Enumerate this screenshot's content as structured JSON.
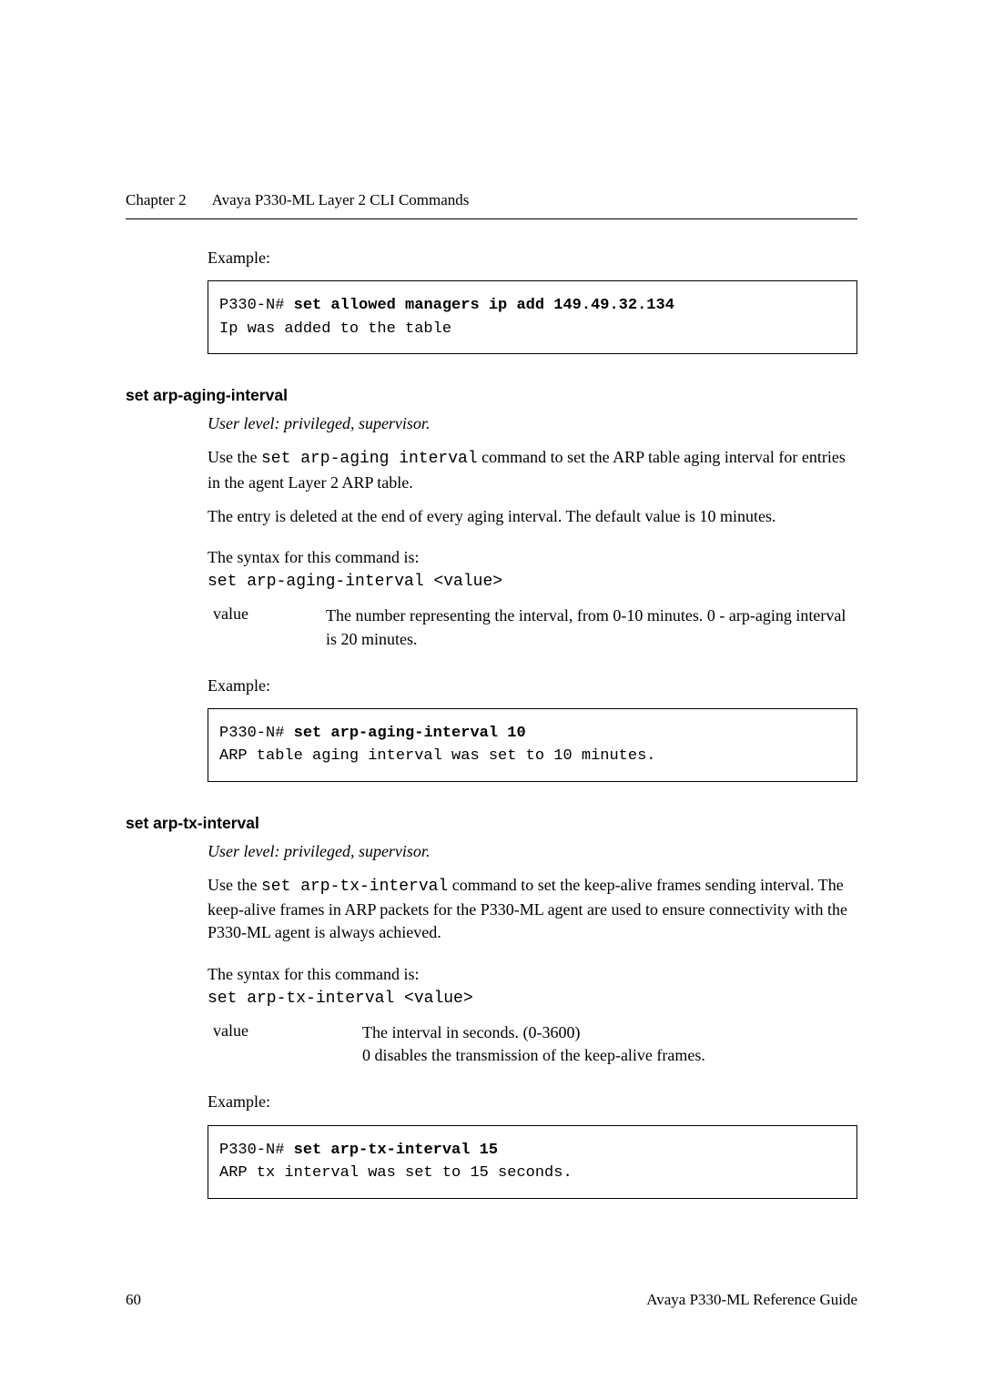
{
  "header": {
    "chapter": "Chapter 2",
    "title": "Avaya P330-ML Layer 2 CLI Commands"
  },
  "example_label": "Example:",
  "code1": {
    "prompt": "P330-N# ",
    "command": "set allowed managers ip add 149.49.32.134",
    "output": "Ip was added to the table"
  },
  "section1": {
    "title": "set arp-aging-interval",
    "userlevel": "User level: privileged, supervisor.",
    "desc_pre": "Use the ",
    "desc_cmd": "set arp-aging interval",
    "desc_post": " command to set the ARP table aging interval for entries in the agent Layer 2 ARP table.",
    "desc2": "The entry is deleted at the end of every aging interval. The default value is 10 minutes.",
    "syntax_intro": "The syntax for this command is:",
    "syntax_code": "set arp-aging-interval <value>",
    "param_name": "value",
    "param_desc": "The number representing the interval, from 0-10 minutes. 0 - arp-aging interval is 20 minutes.",
    "code": {
      "prompt": "P330-N# ",
      "command": "set arp-aging-interval 10",
      "output": "ARP table aging interval was set to 10 minutes."
    }
  },
  "section2": {
    "title": "set arp-tx-interval",
    "userlevel": "User level: privileged, supervisor.",
    "desc_pre": "Use the ",
    "desc_cmd": "set arp-tx-interval",
    "desc_post": " command to set the keep-alive frames sending interval. The keep-alive frames in ARP packets for the P330-ML agent are used to ensure connectivity with the P330-ML agent is always achieved.",
    "syntax_intro": "The syntax for this command is:",
    "syntax_code": "set arp-tx-interval <value>",
    "param_name": "value",
    "param_desc_l1": "The interval in seconds. (0-3600)",
    "param_desc_l2": "0 disables the transmission of the keep-alive frames.",
    "code": {
      "prompt": "P330-N# ",
      "command": "set arp-tx-interval 15",
      "output": "ARP tx interval was set to 15 seconds."
    }
  },
  "footer": {
    "page": "60",
    "ref": "Avaya P330-ML Reference Guide"
  }
}
